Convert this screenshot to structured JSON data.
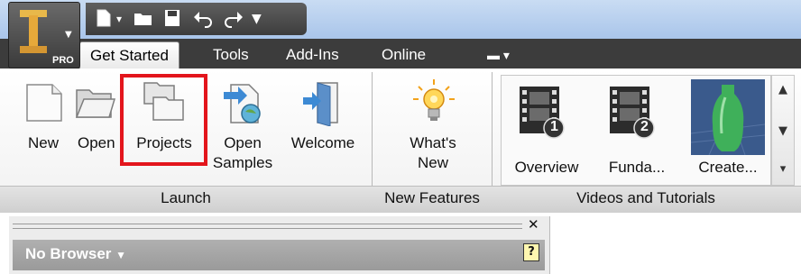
{
  "app": {
    "logo_letter": "I",
    "edition_badge": "PRO"
  },
  "quick_access": {
    "icons": [
      "new-doc-icon",
      "open-folder-icon",
      "save-icon",
      "undo-icon",
      "redo-icon",
      "customize-icon"
    ]
  },
  "tabs": [
    {
      "label": "Get Started",
      "active": true
    },
    {
      "label": "Tools",
      "active": false
    },
    {
      "label": "Add-Ins",
      "active": false
    },
    {
      "label": "Online",
      "active": false
    }
  ],
  "tabs_extra_icon": "panel-toggle-icon",
  "ribbon": {
    "launch": {
      "title": "Launch",
      "tools": [
        {
          "label": "New",
          "icon": "new-document-icon"
        },
        {
          "label": "Open",
          "icon": "open-folder-icon"
        },
        {
          "label": "Projects",
          "icon": "projects-icon"
        },
        {
          "label": "Open",
          "label2": "Samples",
          "icon": "open-samples-icon"
        },
        {
          "label": "Welcome",
          "icon": "welcome-door-icon"
        }
      ]
    },
    "new_features": {
      "title": "New Features",
      "tools": [
        {
          "label": "What's",
          "label2": "New",
          "icon": "lightbulb-icon"
        }
      ]
    },
    "videos": {
      "title": "Videos and Tutorials",
      "items": [
        {
          "label": "Overview",
          "badge": "1",
          "icon": "film-icon"
        },
        {
          "label": "Funda...",
          "badge": "2",
          "icon": "film-icon"
        },
        {
          "label": "Create...",
          "icon": "bottle-thumbnail"
        }
      ]
    }
  },
  "browser": {
    "title": "No Browser",
    "help_label": "?"
  },
  "colors": {
    "highlight": "#e3151c",
    "tab_bar": "#3c3c3c",
    "title_bar": "#a9c5ea"
  }
}
